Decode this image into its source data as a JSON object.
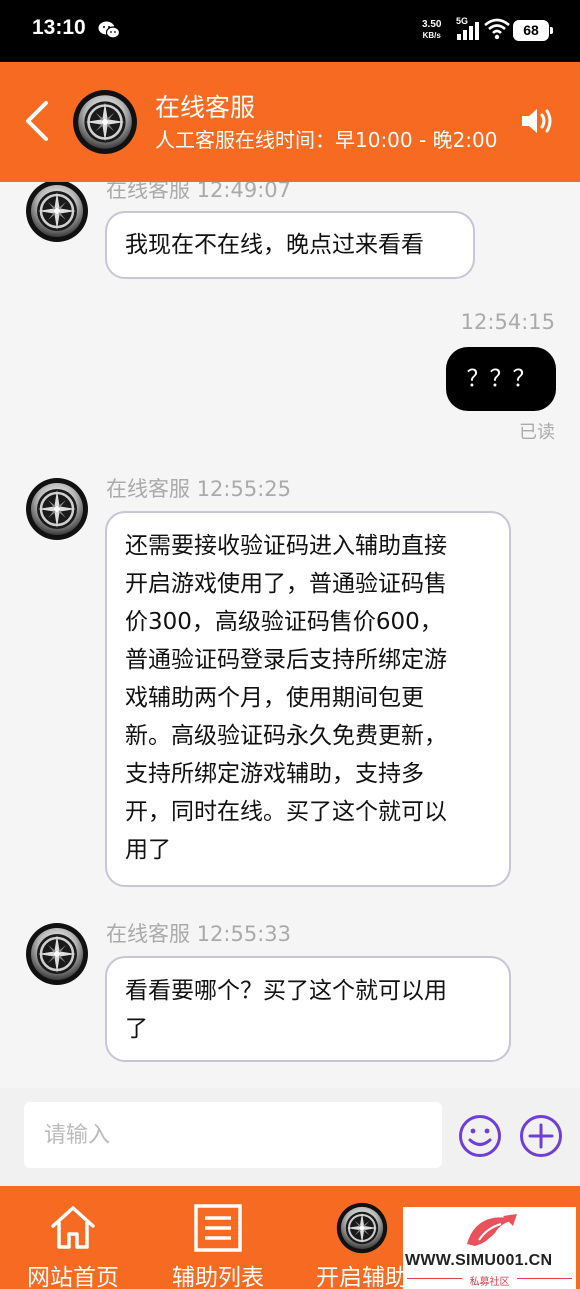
{
  "status_bar": {
    "time": "13:10",
    "net_speed_value": "3.50",
    "net_speed_unit": "KB/s",
    "network_type": "5G",
    "battery": "68"
  },
  "header": {
    "title": "在线客服",
    "subtitle": "人工客服在线时间：早10:00 - 晚2:00"
  },
  "messages": [
    {
      "sender": "在线客服",
      "time": "12:49:07",
      "text": "我现在不在线，晚点过来看看"
    },
    {
      "time": "12:54:15",
      "text": "？？？",
      "status": "已读"
    },
    {
      "sender": "在线客服",
      "time": "12:55:25",
      "lines": [
        "还需要接收验证码进入辅助直接",
        "开启游戏使用了，普通验证码售",
        "价300，高级验证码售价600，",
        "普通验证码登录后支持所绑定游",
        "戏辅助两个月，使用期间包更",
        "新。高级验证码永久免费更新，",
        "支持所绑定游戏辅助，支持多",
        "开，同时在线。买了这个就可以",
        "用了"
      ]
    },
    {
      "sender": "在线客服",
      "time": "12:55:33",
      "lines": [
        "看看要哪个？买了这个就可以用",
        "了"
      ]
    }
  ],
  "input": {
    "placeholder": "请输入"
  },
  "nav": [
    {
      "label": "网站首页",
      "icon": "home-icon"
    },
    {
      "label": "辅助列表",
      "icon": "list-icon"
    },
    {
      "label": "开启辅助",
      "icon": "compass-logo-icon"
    }
  ],
  "watermark": {
    "text": "WWW.SIMU001.CN",
    "sub": "私募社区"
  },
  "colors": {
    "brand": "#f76a22",
    "bubble_border": "#c6c6d6",
    "meta_text": "#aaaaaa"
  }
}
